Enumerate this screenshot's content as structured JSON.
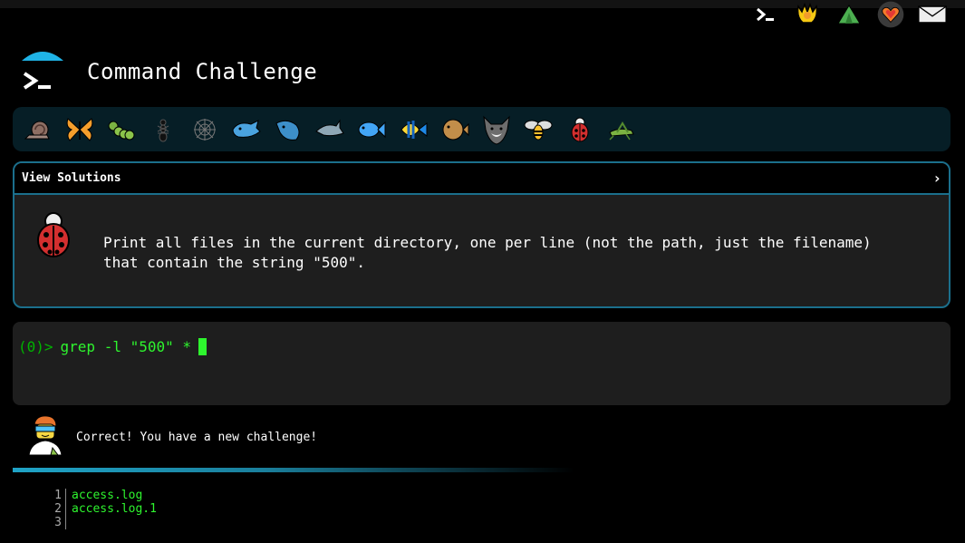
{
  "app": {
    "title": "Command Challenge"
  },
  "top_icons": [
    "terminal-icon",
    "hands-icon",
    "tent-icon",
    "heart-icon",
    "mail-icon"
  ],
  "animals": [
    "snail",
    "butterfly",
    "caterpillar",
    "ant",
    "spider-web",
    "whale",
    "whale-2",
    "dolphin",
    "fish",
    "tropical-fish",
    "blowfish",
    "wolf",
    "bee",
    "ladybug",
    "grasshopper"
  ],
  "challenge": {
    "header": "View Solutions",
    "chevron": "›",
    "description_line1": "Print all files in the current directory, one per line (not the path, just the filename)",
    "description_line2": "that contain the string \"500\"."
  },
  "terminal": {
    "prompt": "(0)>",
    "command": "grep -l \"500\" *"
  },
  "result": {
    "message": "Correct! You have a new challenge!"
  },
  "output": {
    "lines": [
      {
        "num": "1",
        "text": "access.log"
      },
      {
        "num": "2",
        "text": "access.log.1"
      },
      {
        "num": "3",
        "text": ""
      }
    ]
  },
  "colors": {
    "accent": "#1b6f8c",
    "terminal_green": "#2ef52e",
    "header_bg": "#061e26"
  }
}
